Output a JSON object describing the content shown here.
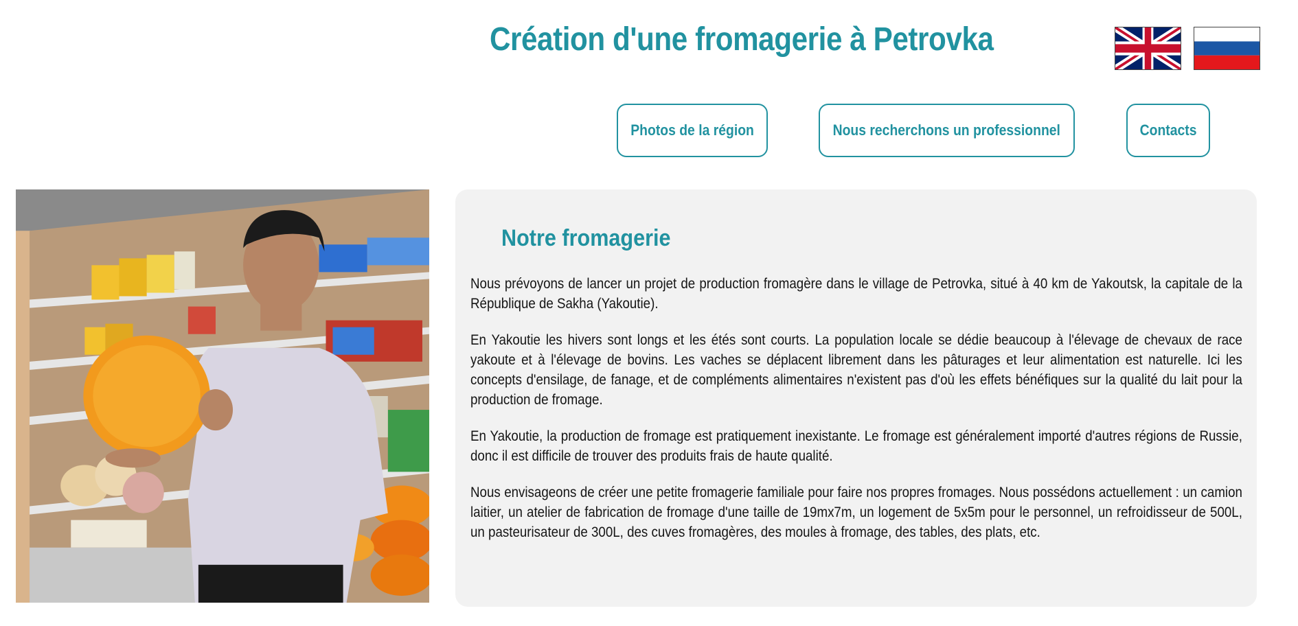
{
  "header": {
    "title": "Création d'une fromagerie à Petrovka",
    "languages": [
      {
        "name": "English",
        "icon": "uk-flag-icon"
      },
      {
        "name": "Русский",
        "icon": "russia-flag-icon"
      }
    ]
  },
  "nav": {
    "items": [
      {
        "label": "Photos de la région"
      },
      {
        "label": "Nous recherchons un professionnel"
      },
      {
        "label": "Contacts"
      }
    ]
  },
  "colors": {
    "accent": "#2192a0",
    "card_background": "#f2f2f2",
    "text": "#151515"
  },
  "main": {
    "photo": {
      "description_icon": "cheesemaker-photo"
    },
    "section_title": "Notre fromagerie",
    "paragraphs": [
      "Nous prévoyons de lancer un projet de production fromagère dans le village de Petrovka, situé à 40 km de Yakoutsk, la capitale de la République de Sakha (Yakoutie).",
      "En Yakoutie les hivers sont longs et les étés sont courts. La population locale se dédie beaucoup à l'élevage de chevaux de race yakoute et à l'élevage de bovins. Les vaches se déplacent librement dans les pâturages et leur alimentation est naturelle. Ici les concepts d'ensilage, de fanage, et de compléments alimentaires n'existent pas d'où les effets bénéfiques sur la qualité du lait pour la production de fromage.",
      "En Yakoutie, la production de fromage est pratiquement inexistante. Le fromage est généralement importé d'autres régions de Russie, donc il est difficile de trouver des produits frais de haute qualité.",
      "Nous envisageons de créer une petite fromagerie familiale pour faire nos propres fromages. Nous possédons actuellement : un camion laitier, un atelier de fabrication de fromage d'une taille de 19mx7m, un logement de 5x5m pour le personnel, un refroidisseur de 500L, un pasteurisateur de 300L, des cuves fromagères, des moules à fromage, des tables, des plats, etc."
    ]
  }
}
